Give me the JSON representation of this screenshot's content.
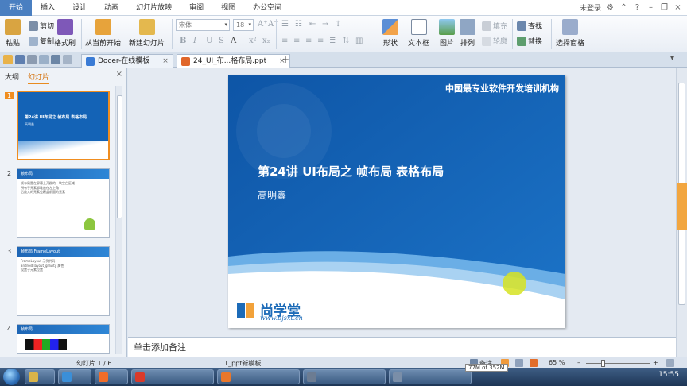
{
  "menu": {
    "tabs": [
      "开始",
      "插入",
      "设计",
      "动画",
      "幻灯片放映",
      "审阅",
      "视图",
      "办公空间"
    ],
    "active": "开始",
    "login": "未登录"
  },
  "ribbon": {
    "paste": "粘贴",
    "cut": "剪切",
    "copy": "复制",
    "format_painter": "格式刷",
    "play_from_current": "从当前开始",
    "new_slide": "新建幻灯片",
    "font_name_placeholder": "宋体",
    "font_size": "18",
    "fill": "填充",
    "outline": "轮廓",
    "shape": "形状",
    "textbox": "文本框",
    "picture": "图片",
    "arrange": "排列",
    "find": "查找",
    "replace": "替换",
    "select_pane": "选择窗格"
  },
  "tabs": {
    "docer": "Docer-在线模板",
    "file": "24_UI_布...格布局.ppt"
  },
  "left_panel": {
    "outline_tab": "大纲",
    "slides_tab": "幻灯片",
    "thumbs": [
      {
        "num": "1",
        "title": "第24讲 UI布局之 帧布局 表格布局",
        "sub": "高明鑫"
      },
      {
        "num": "2",
        "title": "帧布局",
        "lines": [
          "帧布局是在屏幕上开辟的一块空白区域",
          "所有子元素都堆放在左上角",
          "后放入的元素会覆盖前面的元素"
        ]
      },
      {
        "num": "3",
        "title": "帧布局 FrameLayout",
        "lines": [
          "FrameLayout 示例代码",
          "android:layout_gravity 属性",
          "设置子元素位置"
        ]
      },
      {
        "num": "4",
        "title": "帧布局"
      }
    ]
  },
  "slide": {
    "header": "中国最专业软件开发培训机构",
    "title": "第24讲 UI布局之 帧布局  表格布局",
    "subtitle": "高明鑫",
    "logo_text": "尚学堂",
    "logo_url": "www.bjsxt.cn"
  },
  "notes": "单击添加备注",
  "status": {
    "slide_counter": "幻灯片 1 / 6",
    "template": "1_ppt新模板",
    "notes_label": "备注",
    "zoom": "65 %",
    "zoom_fraction": 0.65
  },
  "taskbar": {
    "tooltip": "77M of 352M",
    "clock": "15:55"
  }
}
